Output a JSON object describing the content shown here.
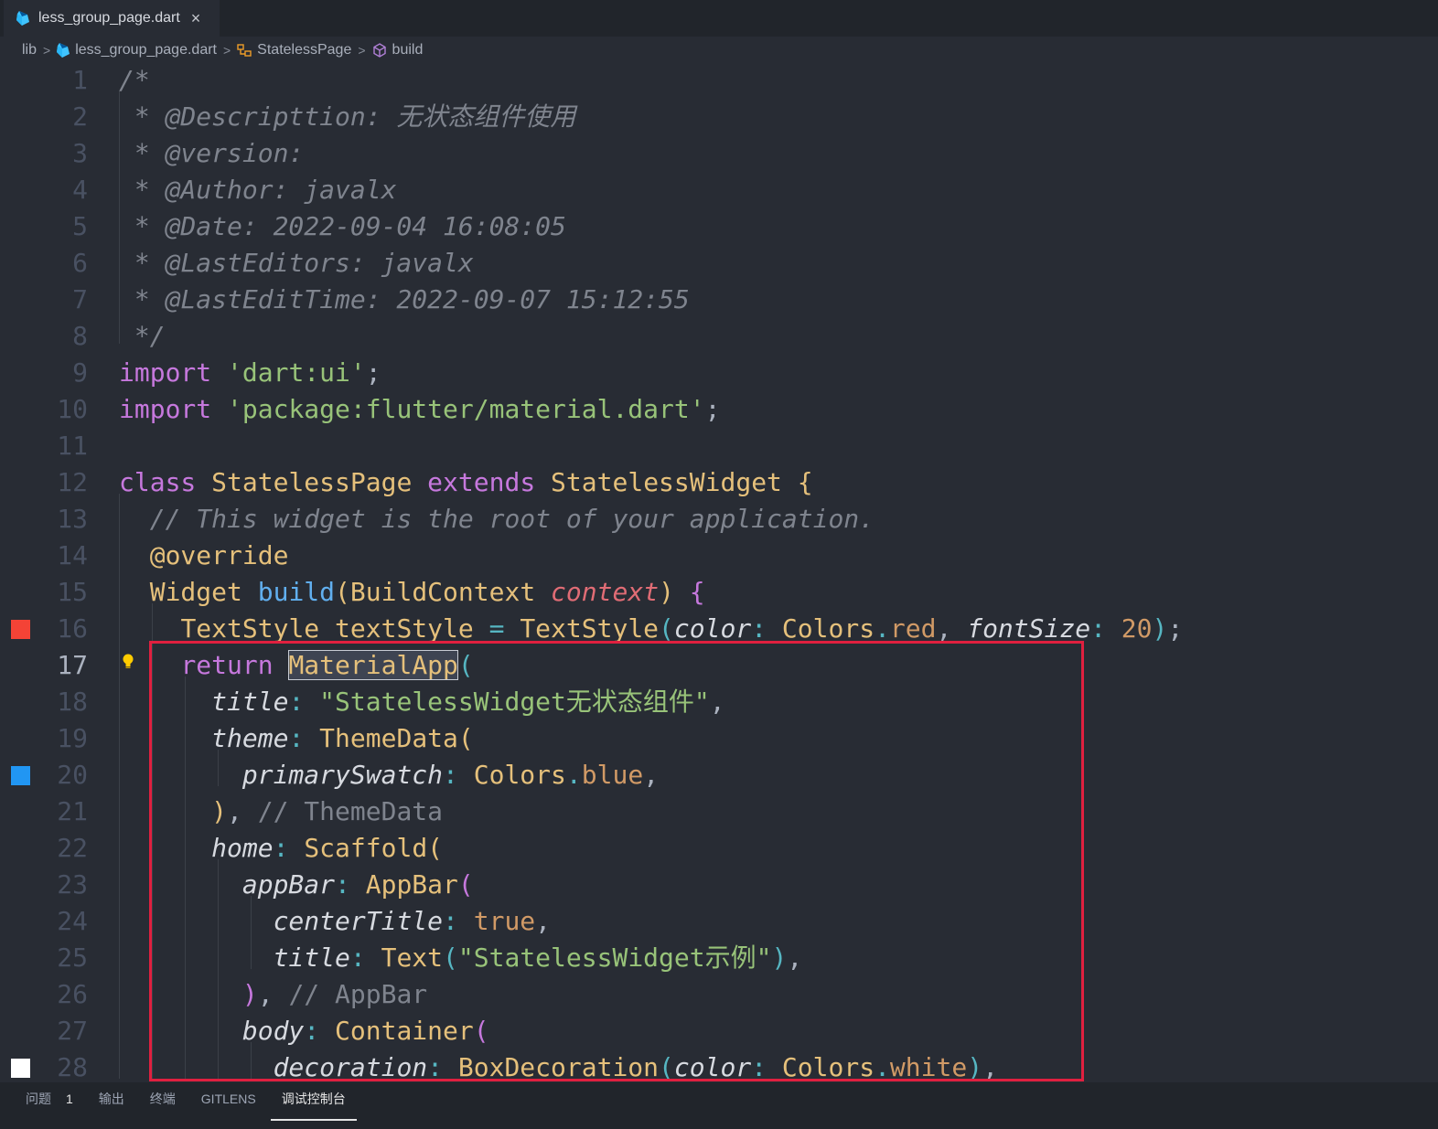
{
  "tab": {
    "filename": "less_group_page.dart",
    "close_glyph": "×",
    "icon": "dart-icon"
  },
  "breadcrumb": {
    "folder": "lib",
    "file": "less_group_page.dart",
    "class": "StatelessPage",
    "method": "build"
  },
  "editor": {
    "active_line": "17",
    "line_numbers": [
      "1",
      "2",
      "3",
      "4",
      "5",
      "6",
      "7",
      "8",
      "9",
      "10",
      "11",
      "12",
      "13",
      "14",
      "15",
      "16",
      "17",
      "18",
      "19",
      "20",
      "21",
      "22",
      "23",
      "24",
      "25",
      "26",
      "27",
      "28"
    ],
    "lines": {
      "l1": "/*",
      "l2": " * @Descripttion: 无状态组件使用",
      "l3": " * @version: ",
      "l4": " * @Author: javalx",
      "l5": " * @Date: 2022-09-04 16:08:05",
      "l6": " * @LastEditors: javalx",
      "l7": " * @LastEditTime: 2022-09-07 15:12:55",
      "l8": " */",
      "l9": {
        "kw": "import",
        "str": "'dart:ui'",
        "end": ";"
      },
      "l10": {
        "kw": "import",
        "str": "'package:flutter/material.dart'",
        "end": ";"
      },
      "l12": {
        "kw1": "class",
        "name": "StatelessPage",
        "kw2": "extends",
        "base": "StatelessWidget",
        "brace": "{"
      },
      "l13": "// This widget is the root of your application.",
      "l14": "@override",
      "l15": {
        "type": "Widget",
        "fn": "build",
        "p1": "(",
        "ptype": "BuildContext",
        "param": "context",
        "p2": ")",
        "brace": "{"
      },
      "l16": {
        "type": "TextStyle",
        "var": "textStyle",
        "eq": "=",
        "ctor": "TextStyle",
        "p1": "(",
        "n1": "color",
        "colon1": ":",
        "cls1": "Colors",
        "dot1": ".",
        "val1": "red",
        "comma": ",",
        "n2": "fontSize",
        "colon2": ":",
        "num": "20",
        "p2": ")",
        "end": ";"
      },
      "l17": {
        "kw": "return",
        "ctor": "MaterialApp",
        "p1": "("
      },
      "l18": {
        "n": "title",
        "colon": ":",
        "str": "\"StatelessWidget无状态组件\"",
        "end": ","
      },
      "l19": {
        "n": "theme",
        "colon": ":",
        "ctor": "ThemeData",
        "p1": "("
      },
      "l20": {
        "n": "primarySwatch",
        "colon": ":",
        "cls": "Colors",
        "dot": ".",
        "val": "blue",
        "end": ","
      },
      "l21": {
        "p": ")",
        "end": ",",
        "com": "// ThemeData"
      },
      "l22": {
        "n": "home",
        "colon": ":",
        "ctor": "Scaffold",
        "p1": "("
      },
      "l23": {
        "n": "appBar",
        "colon": ":",
        "ctor": "AppBar",
        "p1": "("
      },
      "l24": {
        "n": "centerTitle",
        "colon": ":",
        "val": "true",
        "end": ","
      },
      "l25": {
        "n": "title",
        "colon": ":",
        "ctor": "Text",
        "p1": "(",
        "str": "\"StatelessWidget示例\"",
        "p2": ")",
        "end": ","
      },
      "l26": {
        "p": ")",
        "end": ",",
        "com": "// AppBar"
      },
      "l27": {
        "n": "body",
        "colon": ":",
        "ctor": "Container",
        "p1": "("
      },
      "l28": {
        "n": "decoration",
        "colon": ":",
        "ctor": "BoxDecoration",
        "p1": "(",
        "n2": "color",
        "colon2": ":",
        "cls": "Colors",
        "dot": ".",
        "val": "white",
        "p2": ")",
        "end": ","
      }
    },
    "color_markers": {
      "line16": "#f44336",
      "line20": "#2196f3",
      "line28": "#ffffff"
    },
    "lightbulb_icon": "lightbulb-icon",
    "highlight_box_color": "#e0203f"
  },
  "panel": {
    "tabs": [
      {
        "label": "问题",
        "badge": "1"
      },
      {
        "label": "输出"
      },
      {
        "label": "终端"
      },
      {
        "label": "GITLENS"
      },
      {
        "label": "调试控制台",
        "active": true
      }
    ]
  }
}
